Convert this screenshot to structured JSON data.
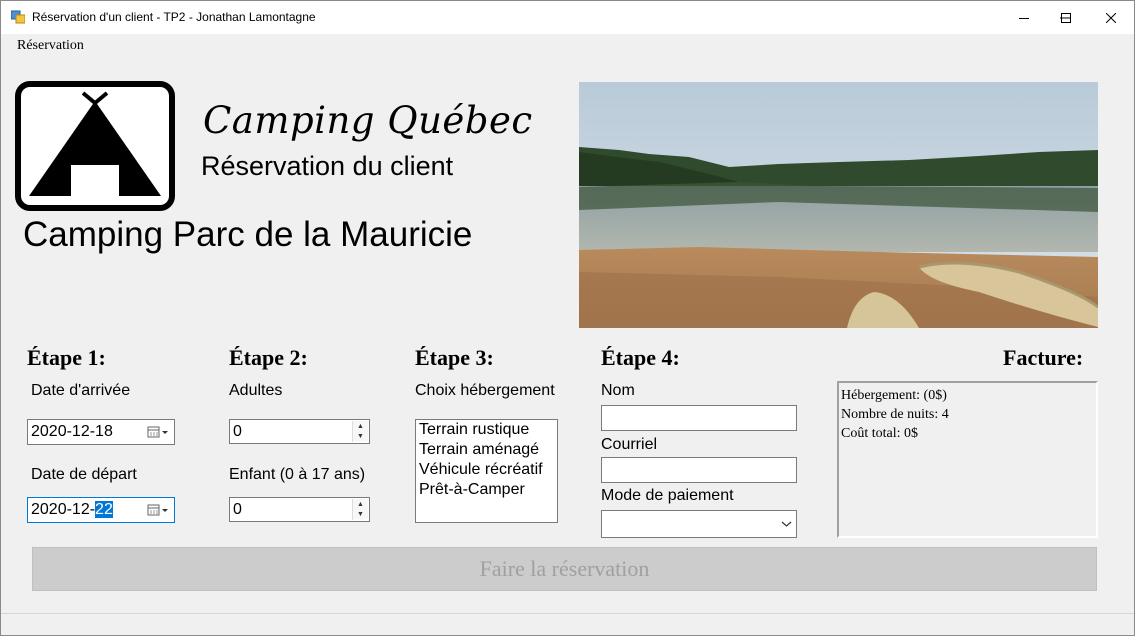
{
  "window": {
    "title": "Réservation d'un client - TP2 - Jonathan Lamontagne",
    "controls": {
      "minimize_icon": "minimize-icon",
      "maximize_icon": "maximize-icon",
      "close_icon": "close-icon"
    }
  },
  "menu": {
    "items": [
      "Réservation"
    ]
  },
  "header": {
    "brand": "Camping Québec",
    "subtitle": "Réservation du client",
    "park": "Camping Parc de la Mauricie",
    "logo_icon": "tent-icon",
    "photo": "lake-beach-canoes-photo"
  },
  "step1": {
    "title": "Étape 1:",
    "arrival_label": "Date d'arrivée",
    "arrival_value": "2020-12-18",
    "departure_label": "Date de départ",
    "departure_value_prefix": "2020-12-",
    "departure_value_selected": "22"
  },
  "step2": {
    "title": "Étape 2:",
    "adults_label": "Adultes",
    "adults_value": "0",
    "children_label": "Enfant (0 à 17 ans)",
    "children_value": "0"
  },
  "step3": {
    "title": "Étape 3:",
    "label": "Choix hébergement",
    "options": [
      "Terrain rustique",
      "Terrain aménagé",
      "Véhicule récréatif",
      "Prêt-à-Camper"
    ]
  },
  "step4": {
    "title": "Étape 4:",
    "name_label": "Nom",
    "name_value": "",
    "email_label": "Courriel",
    "email_value": "",
    "payment_label": "Mode de paiement",
    "payment_value": ""
  },
  "invoice": {
    "title": "Facture:",
    "lines": [
      "Hébergement: (0$)",
      "Nombre de nuits: 4",
      "Coût total: 0$"
    ]
  },
  "submit": {
    "label": "Faire la réservation"
  },
  "colors": {
    "selection": "#0078d7",
    "disabled_button": "#cccccc",
    "disabled_text": "#a0a0a0"
  }
}
